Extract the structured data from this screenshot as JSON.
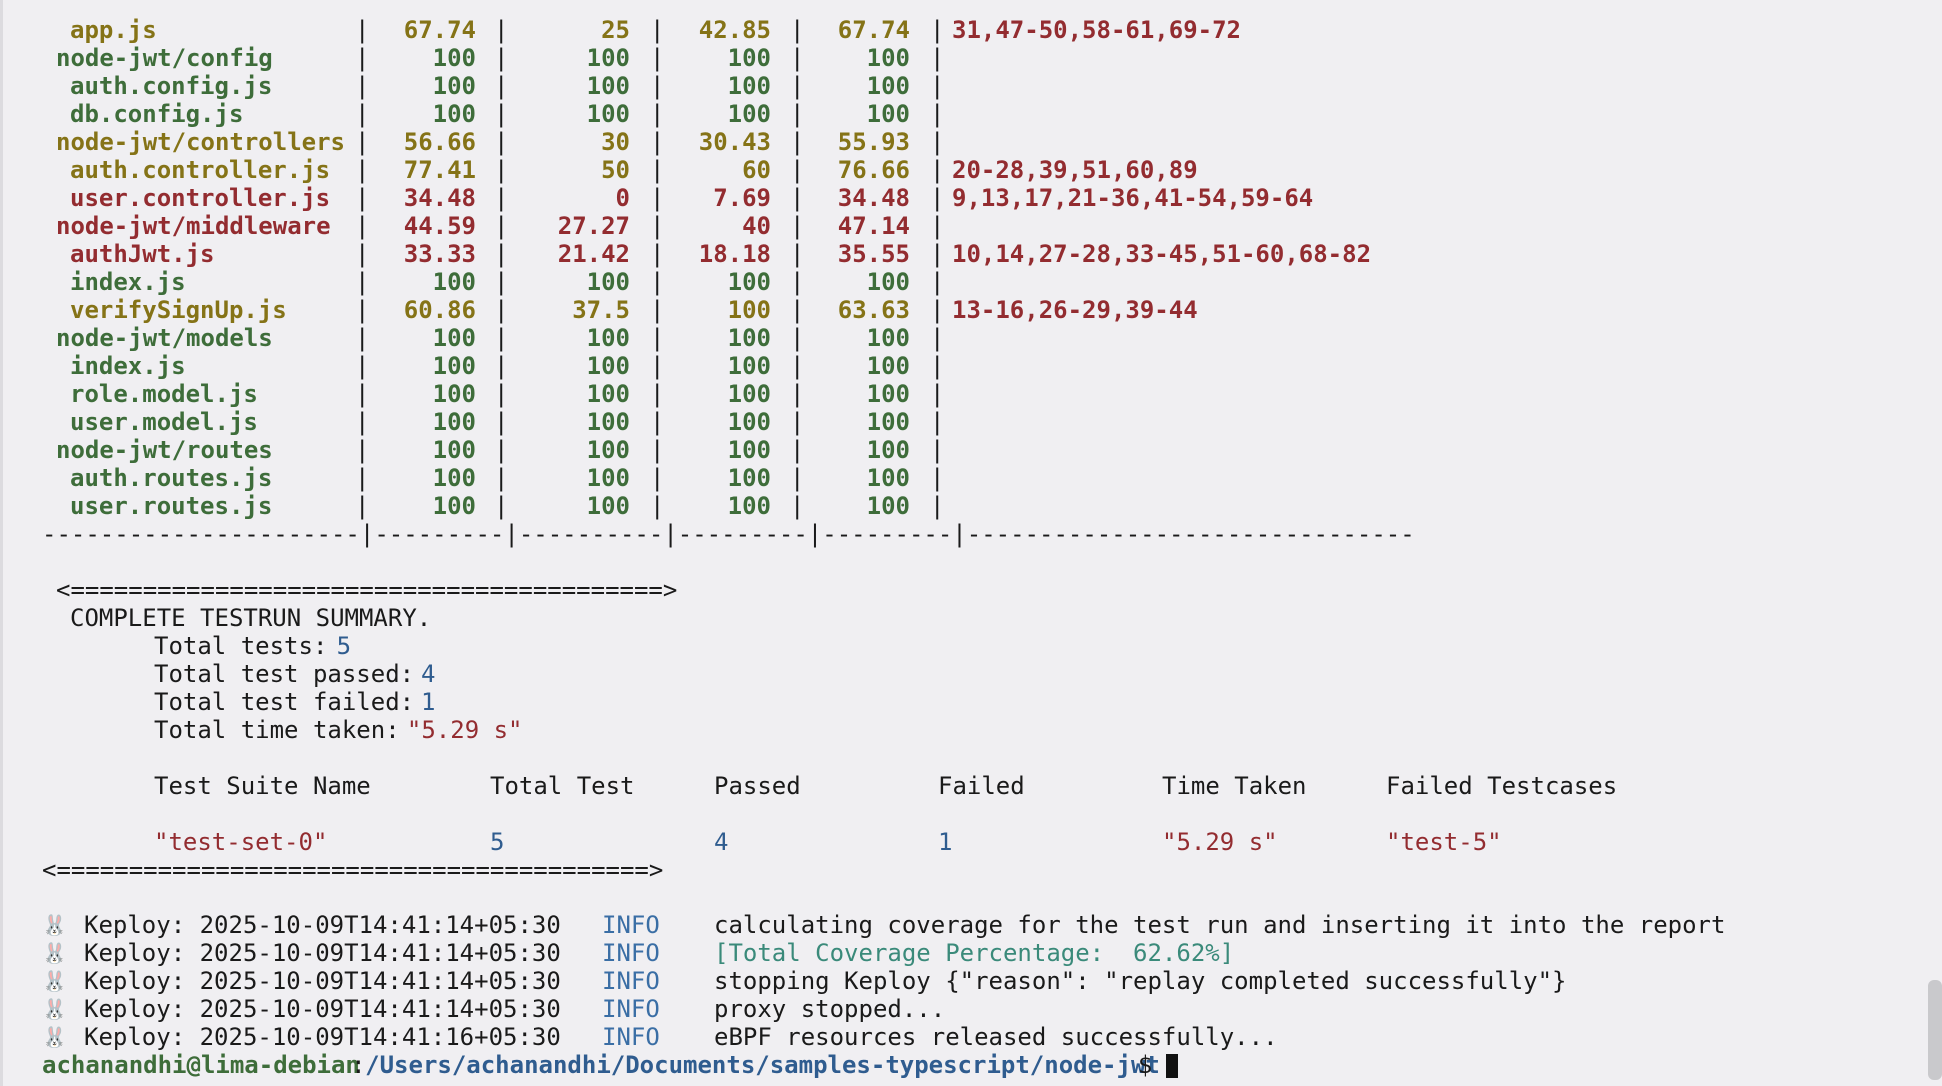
{
  "coverage_table": {
    "rows": [
      {
        "name": "app.js",
        "indent": 2,
        "color": "y",
        "stmts": "67.74",
        "branch": "25",
        "funcs": "42.85",
        "lines": "67.74",
        "uncovered": "31,47-50,58-61,69-72"
      },
      {
        "name": "node-jwt/config",
        "indent": 1,
        "color": "g",
        "stmts": "100",
        "branch": "100",
        "funcs": "100",
        "lines": "100",
        "uncovered": ""
      },
      {
        "name": "auth.config.js",
        "indent": 2,
        "color": "g",
        "stmts": "100",
        "branch": "100",
        "funcs": "100",
        "lines": "100",
        "uncovered": ""
      },
      {
        "name": "db.config.js",
        "indent": 2,
        "color": "g",
        "stmts": "100",
        "branch": "100",
        "funcs": "100",
        "lines": "100",
        "uncovered": ""
      },
      {
        "name": "node-jwt/controllers",
        "indent": 1,
        "color": "y",
        "stmts": "56.66",
        "branch": "30",
        "funcs": "30.43",
        "lines": "55.93",
        "uncovered": ""
      },
      {
        "name": "auth.controller.js",
        "indent": 2,
        "color": "y",
        "stmts": "77.41",
        "branch": "50",
        "funcs": "60",
        "lines": "76.66",
        "uncovered": "20-28,39,51,60,89"
      },
      {
        "name": "user.controller.js",
        "indent": 2,
        "color": "r",
        "stmts": "34.48",
        "branch": "0",
        "funcs": "7.69",
        "lines": "34.48",
        "uncovered": "9,13,17,21-36,41-54,59-64"
      },
      {
        "name": "node-jwt/middleware",
        "indent": 1,
        "color": "r",
        "stmts": "44.59",
        "branch": "27.27",
        "funcs": "40",
        "lines": "47.14",
        "uncovered": ""
      },
      {
        "name": "authJwt.js",
        "indent": 2,
        "color": "r",
        "stmts": "33.33",
        "branch": "21.42",
        "funcs": "18.18",
        "lines": "35.55",
        "uncovered": "10,14,27-28,33-45,51-60,68-82"
      },
      {
        "name": "index.js",
        "indent": 2,
        "color": "g",
        "stmts": "100",
        "branch": "100",
        "funcs": "100",
        "lines": "100",
        "uncovered": ""
      },
      {
        "name": "verifySignUp.js",
        "indent": 2,
        "color": "y",
        "stmts": "60.86",
        "branch": "37.5",
        "funcs": "100",
        "lines": "63.63",
        "uncovered": "13-16,26-29,39-44"
      },
      {
        "name": "node-jwt/models",
        "indent": 1,
        "color": "g",
        "stmts": "100",
        "branch": "100",
        "funcs": "100",
        "lines": "100",
        "uncovered": ""
      },
      {
        "name": "index.js",
        "indent": 2,
        "color": "g",
        "stmts": "100",
        "branch": "100",
        "funcs": "100",
        "lines": "100",
        "uncovered": ""
      },
      {
        "name": "role.model.js",
        "indent": 2,
        "color": "g",
        "stmts": "100",
        "branch": "100",
        "funcs": "100",
        "lines": "100",
        "uncovered": ""
      },
      {
        "name": "user.model.js",
        "indent": 2,
        "color": "g",
        "stmts": "100",
        "branch": "100",
        "funcs": "100",
        "lines": "100",
        "uncovered": ""
      },
      {
        "name": "node-jwt/routes",
        "indent": 1,
        "color": "g",
        "stmts": "100",
        "branch": "100",
        "funcs": "100",
        "lines": "100",
        "uncovered": ""
      },
      {
        "name": "auth.routes.js",
        "indent": 2,
        "color": "g",
        "stmts": "100",
        "branch": "100",
        "funcs": "100",
        "lines": "100",
        "uncovered": ""
      },
      {
        "name": "user.routes.js",
        "indent": 2,
        "color": "g",
        "stmts": "100",
        "branch": "100",
        "funcs": "100",
        "lines": "100",
        "uncovered": ""
      }
    ],
    "bottom_border": "----------------------|---------|----------|---------|---------|-------------------------------"
  },
  "summary": {
    "top_arrow": "<=========================================>",
    "heading": "COMPLETE TESTRUN SUMMARY.",
    "total_tests_label": "Total tests: ",
    "total_tests": "5",
    "passed_label": "Total test passed: ",
    "passed": "4",
    "failed_label": "Total test failed: ",
    "failed": "1",
    "time_label": "Total time taken: ",
    "time": "\"5.29 s\"",
    "columns": [
      "Test Suite Name",
      "Total Test",
      "Passed",
      "Failed",
      "Time Taken",
      "Failed Testcases"
    ],
    "suite_row": {
      "name": "\"test-set-0\"",
      "total": "5",
      "passed": "4",
      "failed": "1",
      "time": "\"5.29 s\"",
      "failed_cases": "\"test-5\""
    },
    "bottom_arrow": "<=========================================>"
  },
  "logs": [
    {
      "prefix": "Keploy: 2025-10-09T14:41:14+05:30",
      "level": "INFO",
      "message": "calculating coverage for the test run and inserting it into the report",
      "highlight": false
    },
    {
      "prefix": "Keploy: 2025-10-09T14:41:14+05:30",
      "level": "INFO",
      "message": "[Total Coverage Percentage:  62.62%]",
      "highlight": true
    },
    {
      "prefix": "Keploy: 2025-10-09T14:41:14+05:30",
      "level": "INFO",
      "message": "stopping Keploy {\"reason\": \"replay completed successfully\"}",
      "highlight": false
    },
    {
      "prefix": "Keploy: 2025-10-09T14:41:14+05:30",
      "level": "INFO",
      "message": "proxy stopped...",
      "highlight": false
    },
    {
      "prefix": "Keploy: 2025-10-09T14:41:16+05:30",
      "level": "INFO",
      "message": "eBPF resources released successfully...",
      "highlight": false
    }
  ],
  "prompt": {
    "user_host": "achanandhi@lima-debian",
    "colon": ":",
    "path": "/Users/achanandhi/Documents/samples-typescript/node-jwt",
    "symbol": "$ "
  },
  "colors": {
    "green": "#3e6d3a",
    "yellow": "#857317",
    "red": "#932c30",
    "blue": "#2f5c8f"
  }
}
